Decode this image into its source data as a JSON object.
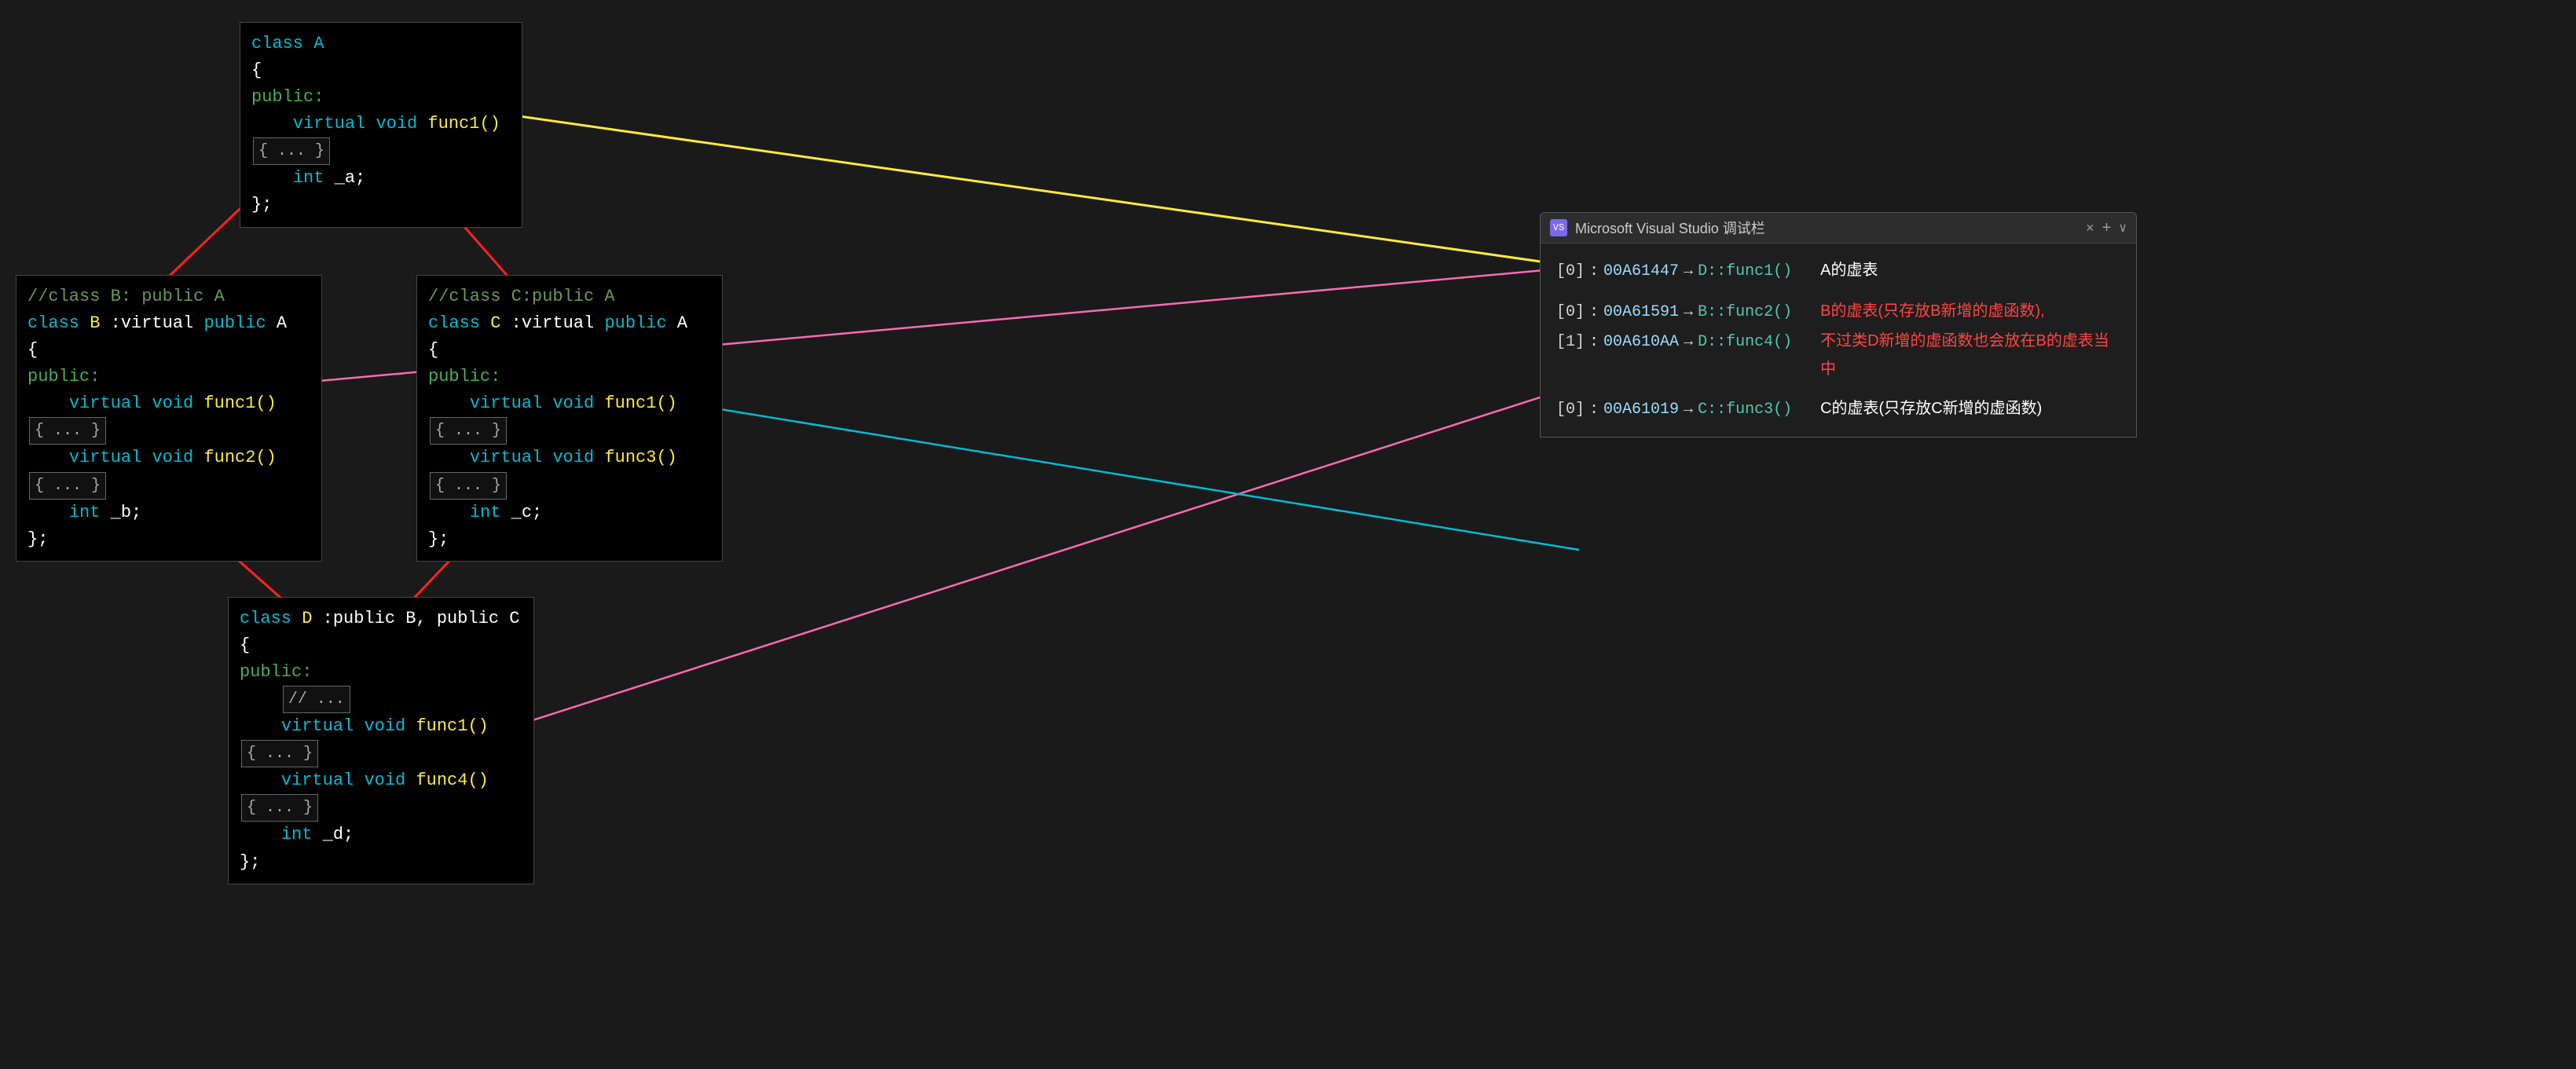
{
  "classA": {
    "title": "class A",
    "brace_open": "{",
    "public": "public:",
    "line1": "virtual void func1()",
    "line1_box": "{ ... }",
    "line2": "int _a;",
    "brace_close": "};"
  },
  "classB": {
    "comment": "//class B: public A",
    "decl": "class B :virtual public A",
    "brace_open": "{",
    "public": "public:",
    "line1": "virtual void func1()",
    "line1_box": "{ ... }",
    "line2": "virtual void func2()",
    "line2_box": "{ ... }",
    "line3": "int _b;",
    "brace_close": "};"
  },
  "classC": {
    "comment": "//class C:public A",
    "decl": "class C :virtual public A",
    "brace_open": "{",
    "public": "public:",
    "line1": "virtual void func1()",
    "line1_box": "{ ... }",
    "line2": "virtual void func3()",
    "line2_box": "{ ... }",
    "line3": "int _c;",
    "brace_close": "};"
  },
  "classD": {
    "decl": "class D :public B, public C",
    "brace_open": "{",
    "public": "public:",
    "comment_line": "// ...",
    "line1": "virtual void func1()",
    "line1_box": "{ ... }",
    "line2": "virtual void func4()",
    "line2_box": "{ ... }",
    "line3": "int _d;",
    "brace_close": "};"
  },
  "vsWindow": {
    "title": "Microsoft Visual Studio 调试栏",
    "close": "×",
    "plus": "+",
    "chevron": "∨",
    "rows": [
      {
        "index": "[0]",
        "separator": ":",
        "addr": "00A61447",
        "arrow": "→",
        "func": "D::func1()",
        "annotation": "A的虚表",
        "annotation_color": "#ffffff"
      },
      {
        "index": "[0]",
        "separator": ":",
        "addr": "00A61591",
        "arrow": "→",
        "func": "B::func2()",
        "annotation": "B的虚表(只存放B新增的虚函数),",
        "annotation_color": "#ff4444"
      },
      {
        "index": "[1]",
        "separator": ":",
        "addr": "00A610AA",
        "arrow": "→",
        "func": "D::func4()",
        "annotation": "不过类D新增的虚函数也会放在B的虚表当中",
        "annotation_color": "#ff4444"
      },
      {
        "index": "[0]",
        "separator": ":",
        "addr": "00A61019",
        "arrow": "→",
        "func": "C::func3()",
        "annotation": "C的虚表(只存放C新增的虚函数)",
        "annotation_color": "#ffffff"
      }
    ]
  }
}
